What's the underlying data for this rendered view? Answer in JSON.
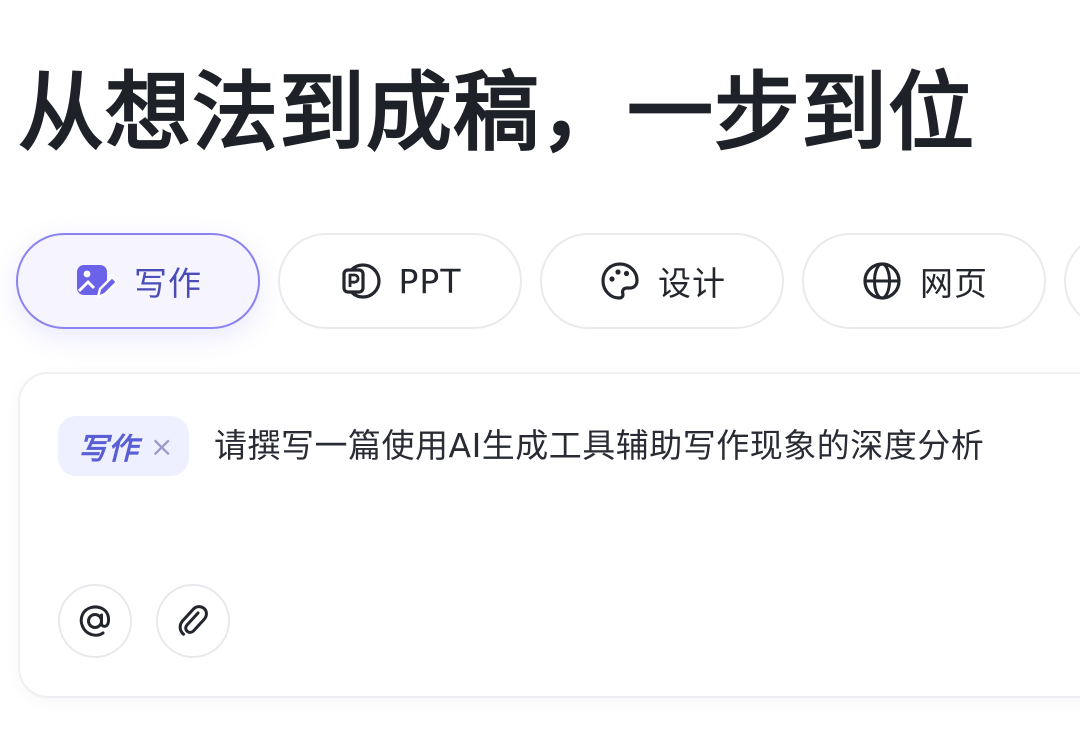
{
  "headline": "从想法到成稿，一步到位",
  "mode_tabs": [
    {
      "label": "写作",
      "icon": "write-image-pencil-icon",
      "active": true
    },
    {
      "label": "PPT",
      "icon": "ppt-icon",
      "active": false
    },
    {
      "label": "设计",
      "icon": "palette-icon",
      "active": false
    },
    {
      "label": "网页",
      "icon": "globe-icon",
      "active": false
    }
  ],
  "composer": {
    "chip_label": "写作",
    "chip_close": "×",
    "prompt_text": "请撰写一篇使用AI生成工具辅助写作现象的深度分析",
    "mention_icon": "at-icon",
    "attach_icon": "paperclip-icon"
  },
  "colors": {
    "accent": "#5a5ed4",
    "active_border": "#8b83f0",
    "chip_bg": "#eef0ff",
    "text_dark": "#1f2129"
  }
}
